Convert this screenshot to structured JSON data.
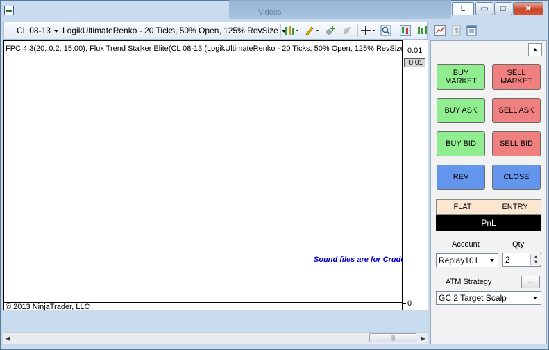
{
  "window": {
    "title_button_L": "L",
    "min_glyph": "▭",
    "max_glyph": "□",
    "close_glyph": "✕",
    "background_fragment": "Videos"
  },
  "toolbar": {
    "instrument": "CL 08-13",
    "period": "LogikUltimateRenko - 20 Ticks, 50% Open, 125% RevSize"
  },
  "chart": {
    "indicator_label": "FPC 4.3(20, 0.2, 15:00), Flux Trend Stalker Elite(CL 08-13 (LogikUltimateRenko - 20 Ticks, 50% Open, 125% RevSize",
    "sound_text": "Sound files are for Crude",
    "copyright": "© 2013 NinjaTrader, LLC",
    "axis_top": "0.01",
    "price_marker": "0.01",
    "axis_zero": "0"
  },
  "scrollbar": {
    "left_arrow": "◀",
    "right_arrow": "▶",
    "thumb_grip": "|||"
  },
  "order_panel": {
    "collapse_glyph": "▲",
    "buy_market": "BUY MARKET",
    "sell_market": "SELL MARKET",
    "buy_ask": "BUY ASK",
    "sell_ask": "SELL ASK",
    "buy_bid": "BUY BID",
    "sell_bid": "SELL BID",
    "rev": "REV",
    "close": "CLOSE",
    "position": "FLAT",
    "entry": "ENTRY",
    "pnl": "PnL",
    "account_label": "Account",
    "qty_label": "Qty",
    "account_value": "Replay101",
    "qty_value": "2",
    "atm_label": "ATM Strategy",
    "atm_dots": "...",
    "atm_value": "GC 2 Target Scalp"
  },
  "colors": {
    "buy": "#90ee90",
    "sell": "#f08080",
    "rev_close": "#6495ed",
    "sound_text": "#0000c8"
  }
}
